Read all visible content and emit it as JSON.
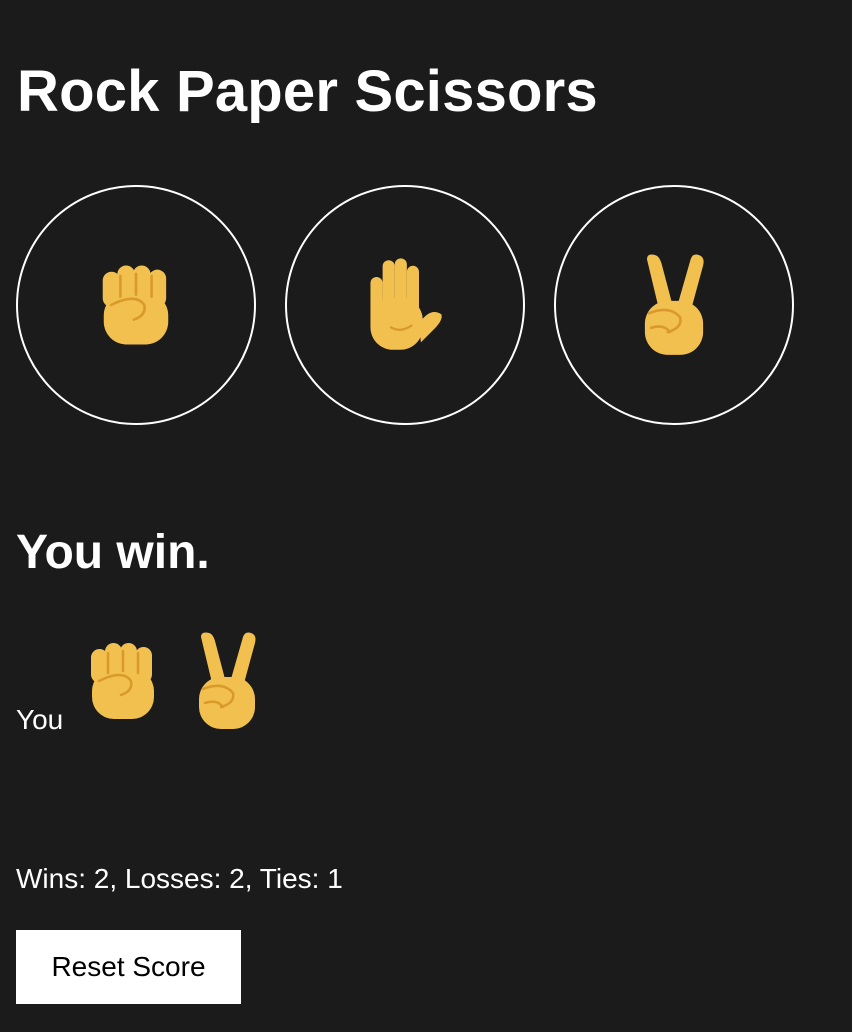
{
  "title": "Rock Paper Scissors",
  "choices": [
    {
      "name": "rock",
      "icon": "raised-fist-icon"
    },
    {
      "name": "paper",
      "icon": "raised-hand-icon"
    },
    {
      "name": "scissors",
      "icon": "victory-hand-icon"
    }
  ],
  "result": {
    "text": "You win."
  },
  "moves": {
    "label": "You",
    "player_icon": "raised-fist-icon",
    "computer_icon": "victory-hand-icon"
  },
  "score": {
    "text": "Wins: 2, Losses: 2, Ties: 1",
    "wins": 2,
    "losses": 2,
    "ties": 1
  },
  "reset_label": "Reset Score",
  "colors": {
    "background": "#1b1b1b",
    "text": "#ffffff",
    "emoji_skin": "#f2c04f",
    "emoji_line": "#d99a2b",
    "button_bg": "#ffffff"
  }
}
